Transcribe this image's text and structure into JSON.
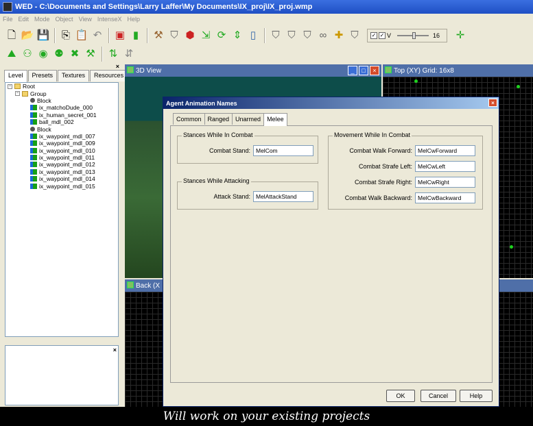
{
  "window": {
    "title": "WED - C:\\Documents and Settings\\Larry Laffer\\My Documents\\IX_proj\\IX_proj.wmp"
  },
  "menu": [
    "File",
    "Edit",
    "Mode",
    "Object",
    "View",
    "IntenseX",
    "Help"
  ],
  "toolbar": {
    "grid_value": "16",
    "slider_label": "V"
  },
  "left_panel": {
    "tabs": [
      "Level",
      "Presets",
      "Textures",
      "Resources"
    ],
    "active_tab": "Level",
    "tree": [
      {
        "label": "Root",
        "type": "folder",
        "level": 0,
        "expander": "−"
      },
      {
        "label": "Group",
        "type": "folder",
        "level": 1,
        "expander": "−"
      },
      {
        "label": "Block",
        "type": "block",
        "level": 2
      },
      {
        "label": "ix_matchoDude_000",
        "type": "mesh",
        "level": 2
      },
      {
        "label": "ix_human_secret_001",
        "type": "mesh",
        "level": 2
      },
      {
        "label": "ball_mdl_002",
        "type": "mesh",
        "level": 2
      },
      {
        "label": "Block",
        "type": "block",
        "level": 2
      },
      {
        "label": "ix_waypoint_mdl_007",
        "type": "mesh",
        "level": 2
      },
      {
        "label": "ix_waypoint_mdl_009",
        "type": "mesh",
        "level": 2
      },
      {
        "label": "ix_waypoint_mdl_010",
        "type": "mesh",
        "level": 2
      },
      {
        "label": "ix_waypoint_mdl_011",
        "type": "mesh",
        "level": 2
      },
      {
        "label": "ix_waypoint_mdl_012",
        "type": "mesh",
        "level": 2
      },
      {
        "label": "ix_waypoint_mdl_013",
        "type": "mesh",
        "level": 2
      },
      {
        "label": "ix_waypoint_mdl_014",
        "type": "mesh",
        "level": 2
      },
      {
        "label": "ix_waypoint_mdl_015",
        "type": "mesh",
        "level": 2
      }
    ]
  },
  "viewports": {
    "view3d": "3D View",
    "top": "Top (XY) Grid: 16x8",
    "back": "Back (X"
  },
  "dialog": {
    "title": "Agent Animation Names",
    "tabs": [
      "Common",
      "Ranged",
      "Unarmed",
      "Melee"
    ],
    "active_tab": "Melee",
    "stances_combat": {
      "legend": "Stances While In Combat",
      "label": "Combat Stand:",
      "value": "MelCom"
    },
    "stances_attacking": {
      "legend": "Stances While Attacking",
      "label": "Attack Stand:",
      "value": "MelAttackStand"
    },
    "movement": {
      "legend": "Movement While In Combat",
      "fields": [
        {
          "label": "Combat Walk Forward:",
          "value": "MelCwForward"
        },
        {
          "label": "Combat Strafe Left:",
          "value": "MelCwLeft"
        },
        {
          "label": "Combat Strafe Right:",
          "value": "MelCwRight"
        },
        {
          "label": "Combat Walk Backward:",
          "value": "MelCwBackward"
        }
      ]
    },
    "buttons": {
      "ok": "OK",
      "cancel": "Cancel",
      "help": "Help"
    }
  },
  "caption": "Will work on your existing projects",
  "colors": {
    "title_bar": "#1f4fc4",
    "viewport_header": "#4f6fa8",
    "dialog_title": "#0a246a",
    "grid_point": "#1fd11f"
  }
}
